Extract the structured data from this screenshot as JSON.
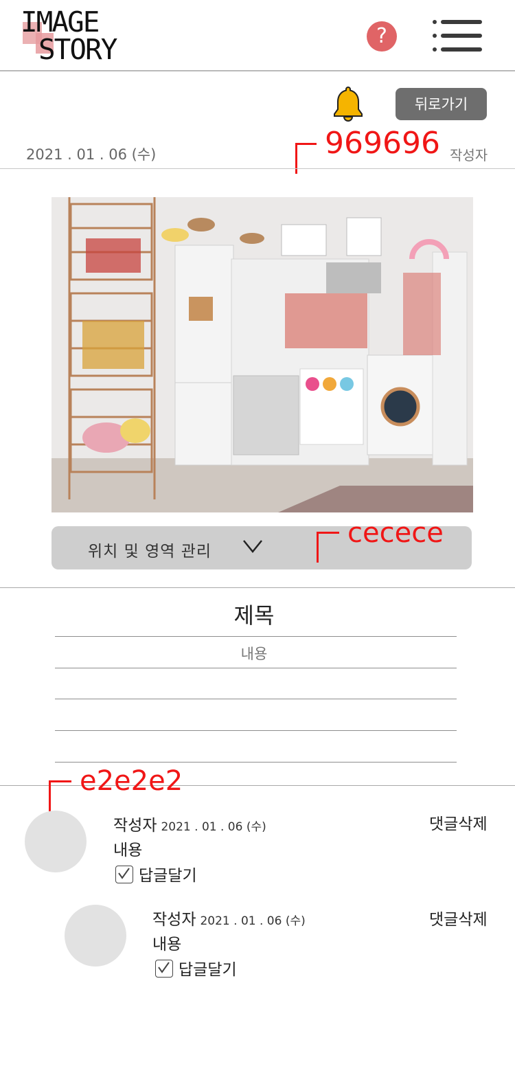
{
  "header": {
    "logo_line1": "IMAGE",
    "logo_line2": "STORY",
    "help_glyph": "?",
    "help_color": "#e06466",
    "menu_icon": "hamburger-menu-icon"
  },
  "meta": {
    "bell_icon": "bell-icon",
    "bell_color": "#f5b400",
    "back_label": "뒤로가기",
    "date": "2021 . 01 . 06 (수)",
    "author_label": "작성자"
  },
  "annotations": {
    "author_color_note": "969696",
    "dropdown_color_note": "cecece",
    "avatar_color_note": "e2e2e2"
  },
  "dropdown": {
    "label": "위치 및 영역 관리",
    "icon": "chevron-down-icon",
    "background": "#cecece"
  },
  "post": {
    "title": "제목",
    "content": "내용"
  },
  "comments": [
    {
      "author": "작성자",
      "date": "2021 . 01 . 06 (수)",
      "body": "내용",
      "reply_label": "답글달기",
      "delete_label": "댓글삭제"
    },
    {
      "author": "작성자",
      "date": "2021 . 01 . 06 (수)",
      "body": "내용",
      "reply_label": "답글달기",
      "delete_label": "댓글삭제"
    }
  ],
  "colors": {
    "avatar": "#e2e2e2",
    "back_button": "#6e6e6e",
    "annotation": "#f01616"
  }
}
